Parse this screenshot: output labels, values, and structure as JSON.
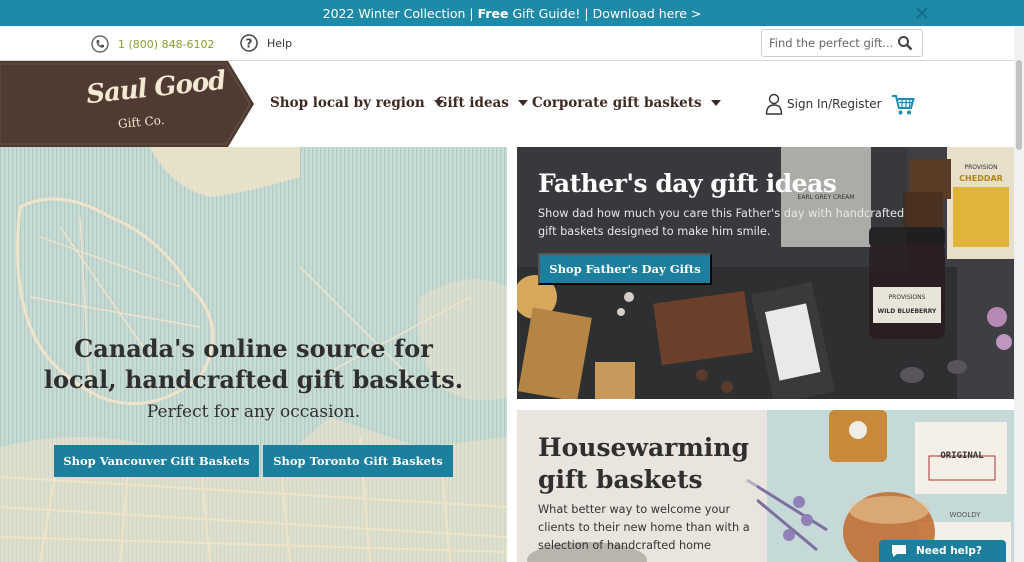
{
  "announcement": {
    "prefix": "2022 Winter Collection |",
    "bold": "Free",
    "middle": "Gift Guide!",
    "separator": "|",
    "link": "Download here >"
  },
  "utility": {
    "phone": "1 (800) 848-6102",
    "help": "Help",
    "search_placeholder": "Find the perfect gift..."
  },
  "brand": {
    "name_line1": "Saul Good",
    "name_line2": "Gift Co."
  },
  "nav": {
    "items": [
      {
        "label": "Shop local by region"
      },
      {
        "label": "Gift ideas"
      },
      {
        "label": "Corporate gift baskets"
      }
    ],
    "signin": "Sign In/Register"
  },
  "hero": {
    "title_line1": "Canada's online source for",
    "title_line2": "local, handcrafted gift baskets.",
    "subtitle": "Perfect for any occasion.",
    "buttons": [
      "Shop Vancouver Gift Baskets",
      "Shop Toronto Gift Baskets"
    ]
  },
  "card_fathers": {
    "title": "Father's day gift ideas",
    "text": "Show dad how much you care this Father's day with handcrafted gift baskets designed to make him smile.",
    "button": "Shop Father's Day Gifts",
    "product_labels": {
      "tea": "EARL GREY CREAM",
      "jam_brand": "PROVISIONS",
      "jam": "WILD BLUEBERRY",
      "cracker_brand": "PROVISION",
      "cracker": "CHEDDAR"
    }
  },
  "card_housewarming": {
    "title_line1": "Housewarming",
    "title_line2": "gift baskets",
    "text": "What better way to welcome your clients to their new home than with a selection of handcrafted home",
    "product_labels": {
      "box1": "ORIGINAL",
      "box2": "WOOLDY"
    }
  },
  "chat": {
    "label": "Need help?"
  },
  "colors": {
    "teal": "#1b7f9d",
    "announcement": "#1d8aa8",
    "logo_bg": "#4f3b31",
    "map_bg": "#c8dcd6",
    "map_lines": "#f1e6cd"
  }
}
